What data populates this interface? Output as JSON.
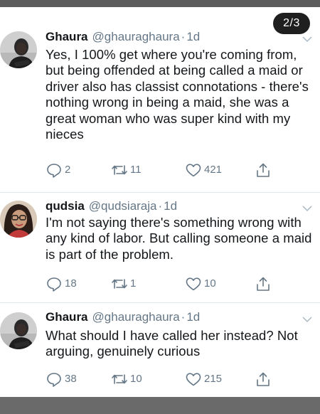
{
  "page_counter": "2/3",
  "tweets": [
    {
      "name": "Ghaura",
      "handle": "@ghauraghaura",
      "separator": "·",
      "time": "1d",
      "text": "Yes, I 100% get where you're coming from, but being offended at being called a maid or driver also has classist connotations - there's nothing wrong in being a maid, she was a great woman who was super kind with my nieces",
      "replies": "2",
      "retweets": "11",
      "likes": "421",
      "avatar_icon": "man-portrait-avatar"
    },
    {
      "name": "qudsia",
      "handle": "@qudsiaraja",
      "separator": "·",
      "time": "1d",
      "text": "I'm not saying there's something wrong with any kind of labor. But calling someone a maid is part of the problem.",
      "replies": "18",
      "retweets": "1",
      "likes": "10",
      "avatar_icon": "woman-with-glasses-avatar"
    },
    {
      "name": "Ghaura",
      "handle": "@ghauraghaura",
      "separator": "·",
      "time": "1d",
      "text": "What should I have called her instead? Not arguing, genuinely curious",
      "replies": "38",
      "retweets": "10",
      "likes": "215",
      "avatar_icon": "man-portrait-avatar"
    }
  ],
  "colors": {
    "text": "#14171a",
    "muted": "#657786",
    "divider": "#e1e8ed",
    "counter_bg": "#1f1f1f"
  }
}
